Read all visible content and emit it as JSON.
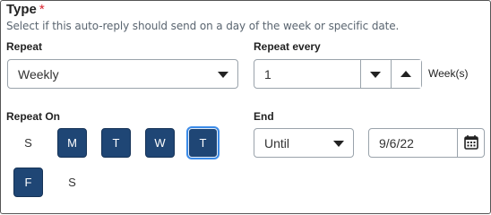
{
  "type": {
    "title": "Type",
    "required_mark": "*",
    "description": "Select if this auto-reply should send on a day of the week or specific date."
  },
  "repeat": {
    "label": "Repeat",
    "value": "Weekly"
  },
  "repeat_every": {
    "label": "Repeat every",
    "value": "1",
    "unit": "Week(s)"
  },
  "repeat_on": {
    "label": "Repeat On",
    "days": [
      {
        "label": "S",
        "selected": false
      },
      {
        "label": "M",
        "selected": true
      },
      {
        "label": "T",
        "selected": true
      },
      {
        "label": "W",
        "selected": true
      },
      {
        "label": "T",
        "selected": true
      },
      {
        "label": "F",
        "selected": true
      },
      {
        "label": "S",
        "selected": false
      }
    ]
  },
  "end": {
    "label": "End",
    "mode": "Until",
    "date": "9/6/22"
  },
  "colors": {
    "selected_day": "#1f4675",
    "required": "#d9232e",
    "focus": "#3b8be8"
  }
}
